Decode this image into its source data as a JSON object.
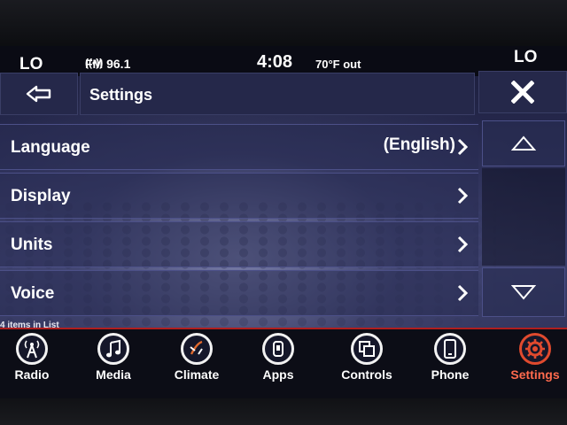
{
  "status": {
    "lo_left": "LO",
    "radio": "FM 96.1",
    "time": "4:08",
    "temp": "70°F out",
    "lo_right": "LO"
  },
  "header": {
    "back_icon": "back-arrow-icon",
    "title": "Settings",
    "close_icon": "close-icon"
  },
  "list": {
    "items": [
      {
        "label": "Language",
        "value": "(English)"
      },
      {
        "label": "Display"
      },
      {
        "label": "Units"
      },
      {
        "label": "Voice"
      }
    ],
    "count_text": "4 items in List"
  },
  "nav": {
    "items": [
      {
        "label": "Radio",
        "icon": "radio-tower-icon"
      },
      {
        "label": "Media",
        "icon": "music-note-icon"
      },
      {
        "label": "Climate",
        "icon": "climate-icon"
      },
      {
        "label": "Apps",
        "icon": "apps-icon"
      },
      {
        "label": "Controls",
        "icon": "controls-icon"
      },
      {
        "label": "Phone",
        "icon": "phone-icon"
      },
      {
        "label": "Settings",
        "icon": "gear-icon"
      }
    ],
    "active": "Settings"
  },
  "colors": {
    "accent": "#e04a2e",
    "panel": "#25284a",
    "background": "#2a2d55"
  }
}
